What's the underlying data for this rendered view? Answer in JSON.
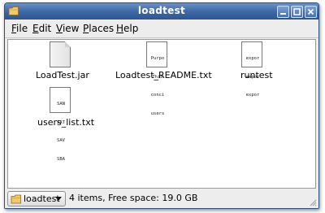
{
  "window": {
    "title": "loadtest",
    "accent": "#3e68a6"
  },
  "menubar": {
    "items": [
      {
        "key": "F",
        "rest": "ile"
      },
      {
        "key": "E",
        "rest": "dit"
      },
      {
        "key": "V",
        "rest": "iew"
      },
      {
        "key": "P",
        "rest": "laces"
      },
      {
        "key": "H",
        "rest": "elp"
      }
    ]
  },
  "files": [
    {
      "name": "LoadTest.jar",
      "icon": "jar-file-icon",
      "preview": []
    },
    {
      "name": "Loadtest_README.txt",
      "icon": "text-file-icon",
      "preview": [
        "Purpo",
        "This",
        "conci",
        "users"
      ]
    },
    {
      "name": "runtest",
      "icon": "script-file-icon",
      "preview": [
        "expor",
        "expor",
        "expor"
      ]
    },
    {
      "name": "users_list.txt",
      "icon": "text-file-icon",
      "preview": [
        "SAN",
        "SAT",
        "SAV",
        "SBA"
      ]
    }
  ],
  "statusbar": {
    "location": "loadtest",
    "summary": "4 items, Free space: 19.0 GB"
  }
}
